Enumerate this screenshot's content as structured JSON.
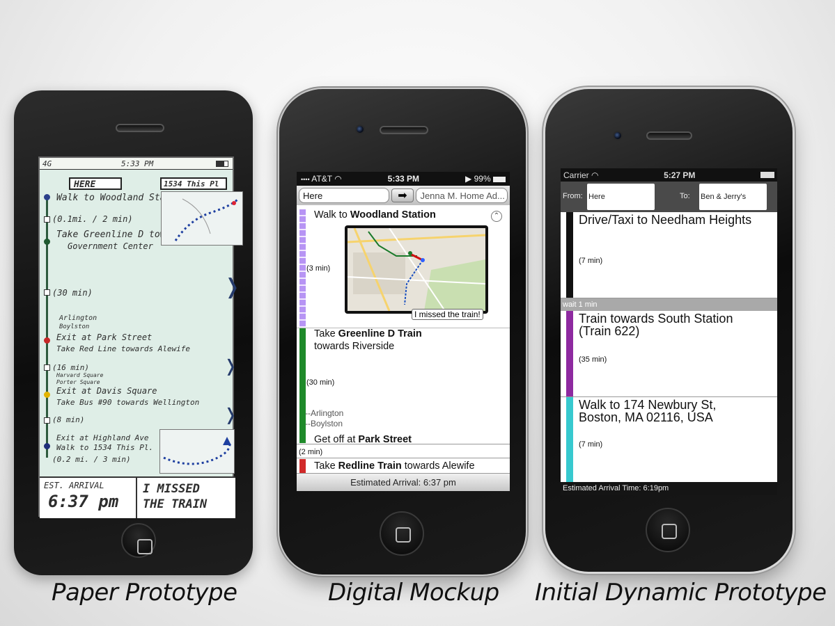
{
  "captions": {
    "paper": "Paper Prototype",
    "digital": "Digital Mockup",
    "dynamic": "Initial Dynamic Prototype"
  },
  "paper": {
    "status": {
      "signal": "4G",
      "time": "5:33",
      "ampm": "PM"
    },
    "from": "HERE",
    "to": "1534 This Pl",
    "lines": [
      "Walk to Woodland Sta",
      "(0.1mi. / 2 min)",
      "Take Greenline D tow",
      "Government Center",
      "(30 min)",
      "Arlington",
      "Boylston",
      "Exit at Park Street",
      "Take Red Line towards Alewife",
      "(16 min)",
      "Harvard Square",
      "Porter Square",
      "Exit at Davis Square",
      "Take Bus #90 towards Wellington",
      "(8 min)",
      "Exit at Highland Ave",
      "Walk to 1534 This Pl.",
      "(0.2 mi. / 3 min)"
    ],
    "est_label": "EST. ARRIVAL",
    "est_time": "6:37 pm",
    "missed_line1": "I MISSED",
    "missed_line2": "THE TRAIN"
  },
  "digital": {
    "status": {
      "carrier": "AT&T",
      "time": "5:33 PM",
      "battery": "99%"
    },
    "from_value": "Here",
    "to_value": "Jenna M. Home Ad...",
    "step1": {
      "prefix": "Walk to ",
      "bold": "Woodland Station",
      "duration": "(3 min)"
    },
    "missed_button": "I missed the train!",
    "step2": {
      "prefix": "Take ",
      "bold": "Greenline D Train",
      "line2": "towards Riverside",
      "duration": "(30 min)"
    },
    "stops": [
      "--Arlington",
      "--Boylston"
    ],
    "getoff": {
      "prefix": "Get off at ",
      "bold": "Park Street"
    },
    "walk_duration": "(2 min)",
    "step3": {
      "prefix": "Take ",
      "bold": "Redline Train",
      "suffix": " towards Alewife"
    },
    "arrival": "Estimated Arrival: 6:37 pm",
    "colors": {
      "walk": "#b794f4",
      "green": "#1f8a2a",
      "red": "#d12a2a"
    }
  },
  "dynamic": {
    "status": {
      "carrier": "Carrier",
      "time": "5:27 PM"
    },
    "from_label": "From:",
    "from_value": "Here",
    "to_label": "To:",
    "to_value": "Ben & Jerry's",
    "steps": [
      {
        "title": "Drive/Taxi to Needham Heights",
        "duration": "(7 min)",
        "color": "#111111"
      },
      {
        "title": "Train towards South Station\n(Train 622)",
        "duration": "(35 min)",
        "color": "#8e2aa0"
      },
      {
        "title": "Walk to 174 Newbury St,\nBoston, MA 02116, USA",
        "duration": "(7 min)",
        "color": "#37c9cf"
      }
    ],
    "wait": "wait 1 min",
    "arrival": "Estimated Arrival Time: 6:19pm"
  }
}
